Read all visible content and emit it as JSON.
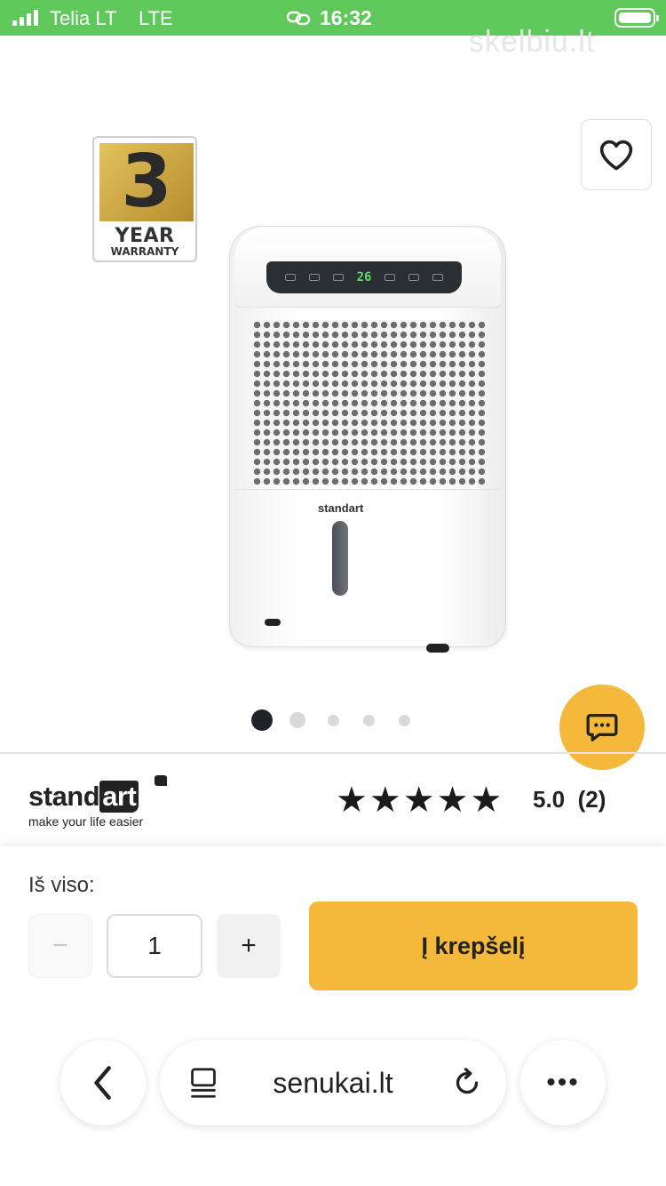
{
  "status_bar": {
    "carrier": "Telia LT",
    "network": "LTE",
    "time": "16:32",
    "icons": [
      "signal-bars-icon",
      "link-icon",
      "battery-icon"
    ],
    "background": "#5fc85a"
  },
  "watermark": "skelbiu.lt",
  "gallery": {
    "warranty_badge": {
      "number": "3",
      "line1": "YEAR",
      "line2": "WARRANTY"
    },
    "product_display_readout": "26",
    "product_brand_mark": "standart",
    "favorite_icon": "heart-icon",
    "dots_total": 5,
    "dots_active_index": 0
  },
  "chat_button": {
    "icon": "chat-bubble-icon",
    "color": "#f4b83b"
  },
  "brand": {
    "name_part1": "stand",
    "name_part2": "art",
    "tagline": "make your life easier"
  },
  "rating": {
    "stars": 5,
    "score": "5.0",
    "count": "(2)"
  },
  "purchase": {
    "total_label": "Iš viso:",
    "minus_label": "−",
    "quantity": "1",
    "plus_label": "+",
    "add_to_cart_label": "Į krepšelį",
    "accent_color": "#f4b83b"
  },
  "browser_toolbar": {
    "url": "senukai.lt",
    "back_icon": "chevron-left-icon",
    "reader_icon": "reader-mode-icon",
    "reload_icon": "reload-icon",
    "more_label": "•••"
  }
}
